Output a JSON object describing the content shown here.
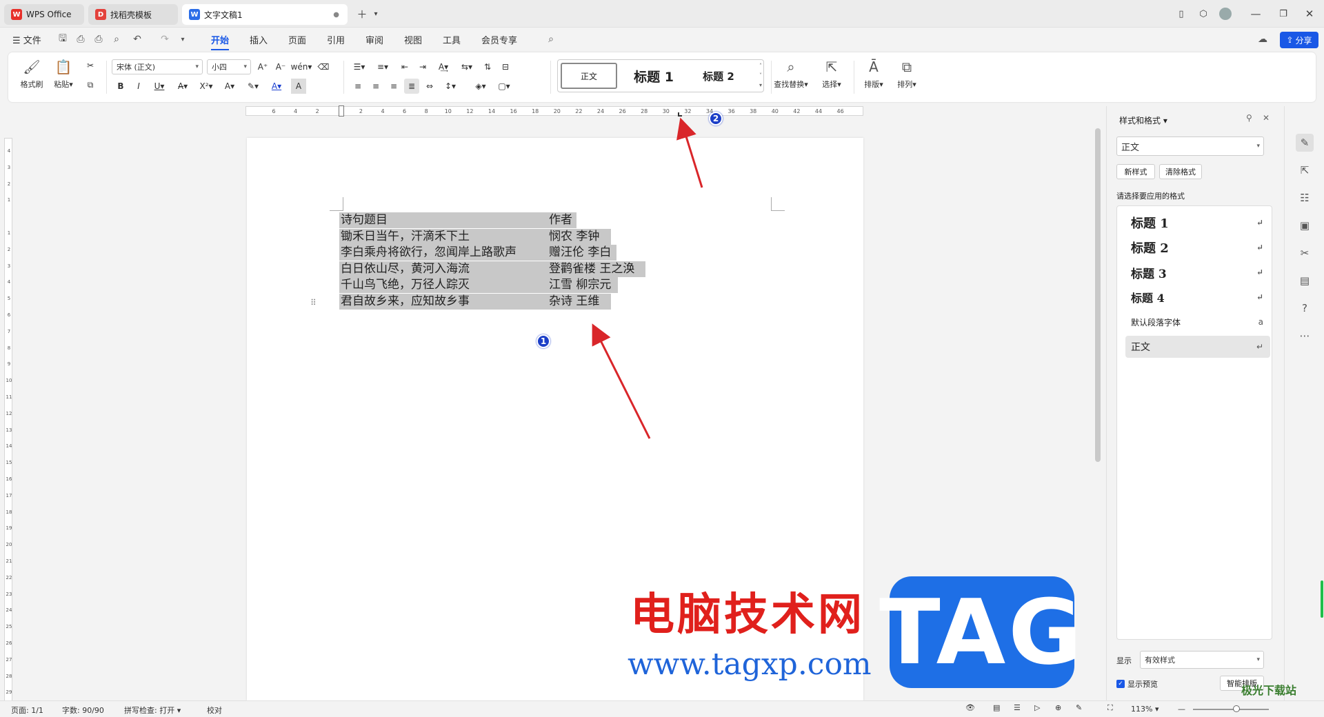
{
  "tabs": [
    {
      "label": "WPS Office",
      "icon": "wps-logo-icon"
    },
    {
      "label": "找稻壳模板",
      "icon": "docer-icon"
    },
    {
      "label": "文字文稿1",
      "icon": "writer-doc-icon"
    }
  ],
  "file_menu": "文件",
  "menus": [
    "开始",
    "插入",
    "页面",
    "引用",
    "审阅",
    "视图",
    "工具",
    "会员专享"
  ],
  "share_label": "分享",
  "ribbon": {
    "format_painter": "格式刷",
    "paste": "粘贴",
    "font_name": "宋体 (正文)",
    "font_size": "小四",
    "styles": [
      "正文",
      "标题 1",
      "标题 2"
    ],
    "find_replace": "查找替换",
    "select": "选择",
    "typeset": "排版",
    "arrange": "排列"
  },
  "ruler_h_ticks": [
    "6",
    "4",
    "2",
    "",
    "2",
    "4",
    "6",
    "8",
    "10",
    "12",
    "14",
    "16",
    "18",
    "20",
    "22",
    "24",
    "26",
    "28",
    "30",
    "32",
    "34",
    "36",
    "38",
    "40",
    "42",
    "44",
    "46"
  ],
  "ruler_v_ticks": [
    "4",
    "3",
    "2",
    "1",
    "",
    "1",
    "2",
    "3",
    "4",
    "5",
    "6",
    "7",
    "8",
    "9",
    "10",
    "11",
    "12",
    "13",
    "14",
    "15",
    "16",
    "17",
    "18",
    "19",
    "20",
    "21",
    "22",
    "23",
    "24",
    "25",
    "26",
    "27",
    "28",
    "29"
  ],
  "document": {
    "rows": [
      {
        "title": "诗句题目",
        "author": "作者"
      },
      {
        "title": "锄禾日当午，汗滴禾下土",
        "author": "悯农  李钟"
      },
      {
        "title": "李白乘舟将欲行，忽闻岸上路歌声",
        "author": "赠汪伦  李白"
      },
      {
        "title": "白日依山尽，黄河入海流",
        "author": "登鹳雀楼  王之涣"
      },
      {
        "title": "千山鸟飞绝，万径人踪灭",
        "author": "江雪  柳宗元"
      },
      {
        "title": "君自故乡来，应知故乡事",
        "author": "杂诗  王维"
      }
    ]
  },
  "annotations": {
    "badge1": "1",
    "badge2": "2",
    "arrow_color": "#d9262a"
  },
  "side_panel": {
    "title": "样式和格式",
    "current_style": "正文",
    "new_style": "新样式",
    "clear_format": "清除格式",
    "prompt": "请选择要应用的格式",
    "items": [
      {
        "label": "标题  1",
        "mark": "↵"
      },
      {
        "label": "标题  2",
        "mark": "↵"
      },
      {
        "label": "标题  3",
        "mark": "↵"
      },
      {
        "label": "标题 4",
        "mark": "↵"
      },
      {
        "label": "默认段落字体",
        "mark": "a"
      },
      {
        "label": "正文",
        "mark": "↵"
      }
    ],
    "show_label": "显示",
    "show_value": "有效样式",
    "preview_label": "显示预览",
    "smart_typeset": "智能排版"
  },
  "status": {
    "page": "页面: 1/1",
    "words": "字数: 90/90",
    "spell": "拼写检查: 打开 ▾",
    "proof": "校对",
    "zoom": "113%"
  },
  "watermark": {
    "cn": "电脑技术网",
    "url": "www.tagxp.com",
    "tag": "TAG",
    "corner": "极光下载站"
  },
  "colors": {
    "accent": "#1a58e6",
    "selection": "#c8c8c8",
    "badge": "#1c3fc8"
  }
}
